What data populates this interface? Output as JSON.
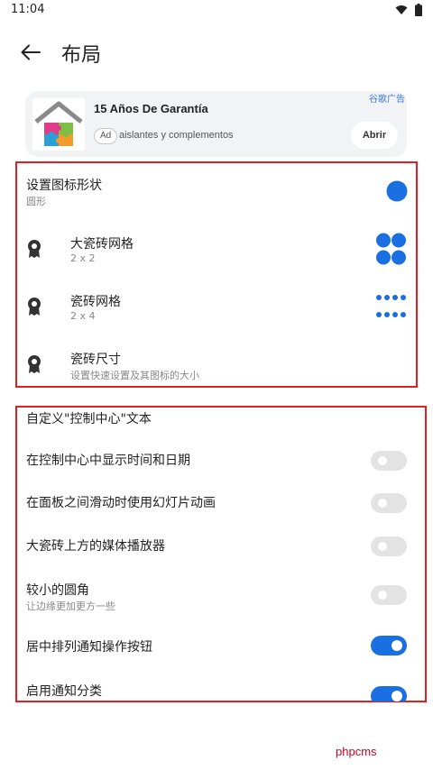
{
  "status_bar": {
    "time": "11:04",
    "icons": [
      "wifi-icon",
      "battery-icon"
    ]
  },
  "app_bar": {
    "title": "布局",
    "back_icon": "arrow-left-icon"
  },
  "ad": {
    "tag": "谷歌广告",
    "title": "15 Años De Garantía",
    "badge": "Ad",
    "description": "aislantes y complementos",
    "button": "Abrir"
  },
  "layout_section": {
    "icon_shape": {
      "title": "设置图标形状",
      "subtitle": "圆形"
    },
    "large_tile_grid": {
      "title": "大瓷砖网格",
      "subtitle": "2 x 2"
    },
    "tile_grid": {
      "title": "瓷砖网格",
      "subtitle": "2 x 4"
    },
    "tile_size": {
      "title": "瓷砖尺寸",
      "subtitle": "设置快速设置及其图标的大小"
    }
  },
  "control_center": {
    "header": "自定义\"控制中心\"文本",
    "items": [
      {
        "title": "在控制中心中显示时间和日期",
        "subtitle": "",
        "on": false
      },
      {
        "title": "在面板之间滑动时使用幻灯片动画",
        "subtitle": "",
        "on": false
      },
      {
        "title": "大瓷砖上方的媒体播放器",
        "subtitle": "",
        "on": false
      },
      {
        "title": "较小的圆角",
        "subtitle": "让边缘更加更方一些",
        "on": false
      },
      {
        "title": "居中排列通知操作按钮",
        "subtitle": "",
        "on": true
      },
      {
        "title": "启用通知分类",
        "subtitle": "",
        "on": true
      }
    ]
  },
  "watermark": "phpcms",
  "colors": {
    "accent": "#1a6fe3",
    "highlight_box": "#e02020",
    "ad_tag": "#3d7bd9"
  }
}
